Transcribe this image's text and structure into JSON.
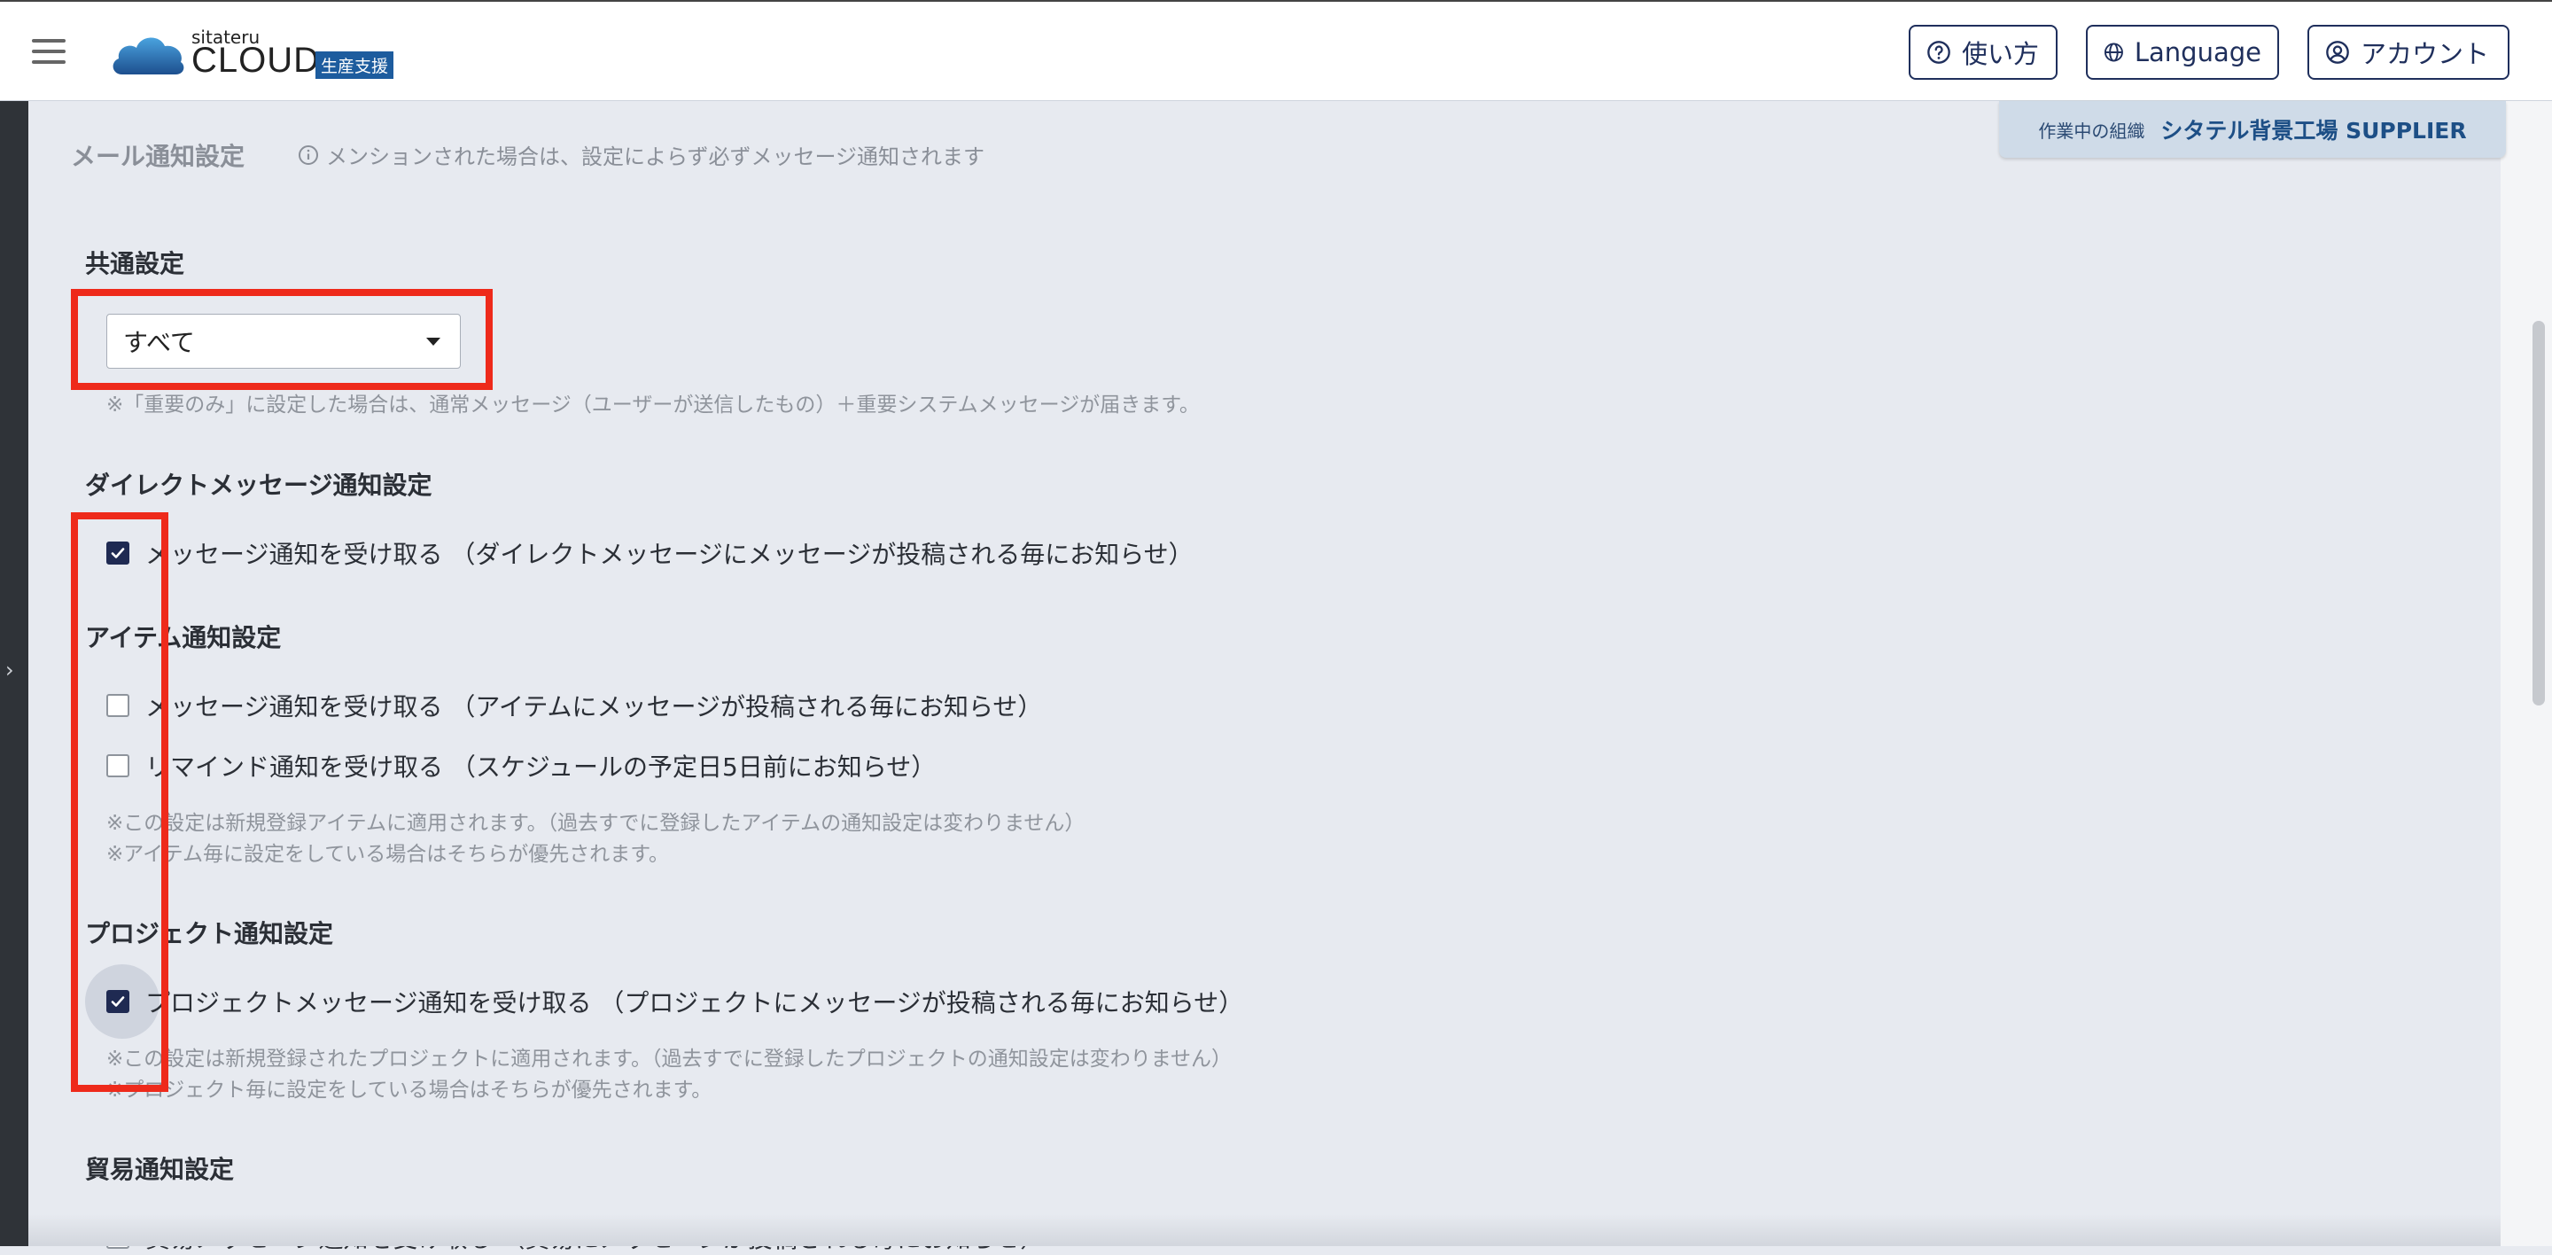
{
  "header": {
    "logo_small": "sitateru",
    "logo_main": "CLOUD",
    "logo_badge": "生産支援",
    "help_label": "使い方",
    "language_label": "Language",
    "account_label": "アカウント"
  },
  "org": {
    "label": "作業中の組織",
    "name": "シタテル背景工場 SUPPLIER"
  },
  "page": {
    "section_title": "メール通知設定",
    "mention_notice": "メンションされた場合は、設定によらず必ずメッセージ通知されます"
  },
  "common": {
    "heading": "共通設定",
    "select_value": "すべて",
    "note": "※「重要のみ」に設定した場合は、通常メッセージ（ユーザーが送信したもの）＋重要システムメッセージが届きます。"
  },
  "direct": {
    "heading": "ダイレクトメッセージ通知設定",
    "option": "メッセージ通知を受け取る （ダイレクトメッセージにメッセージが投稿される毎にお知らせ）",
    "checked": true
  },
  "item": {
    "heading": "アイテム通知設定",
    "options": [
      {
        "label": "メッセージ通知を受け取る （アイテムにメッセージが投稿される毎にお知らせ）",
        "checked": false
      },
      {
        "label": "リマインド通知を受け取る （スケジュールの予定日5日前にお知らせ）",
        "checked": false
      }
    ],
    "note1": "※この設定は新規登録アイテムに適用されます。（過去すでに登録したアイテムの通知設定は変わりません）",
    "note2": "※アイテム毎に設定をしている場合はそちらが優先されます。"
  },
  "project": {
    "heading": "プロジェクト通知設定",
    "option": "プロジェクトメッセージ通知を受け取る （プロジェクトにメッセージが投稿される毎にお知らせ）",
    "checked": true,
    "note1": "※この設定は新規登録されたプロジェクトに適用されます。（過去すでに登録したプロジェクトの通知設定は変わりません）",
    "note2": "※プロジェクト毎に設定をしている場合はそちらが優先されます。"
  },
  "trade": {
    "heading": "貿易通知設定",
    "option": "貿易メッセージ通知を受け取る （貿易にメッセージが投稿される毎にお知らせ）",
    "checked": false
  },
  "colors": {
    "accent": "#1f2a52",
    "highlight": "#ee2a1b",
    "brand": "#1d5c9e"
  }
}
